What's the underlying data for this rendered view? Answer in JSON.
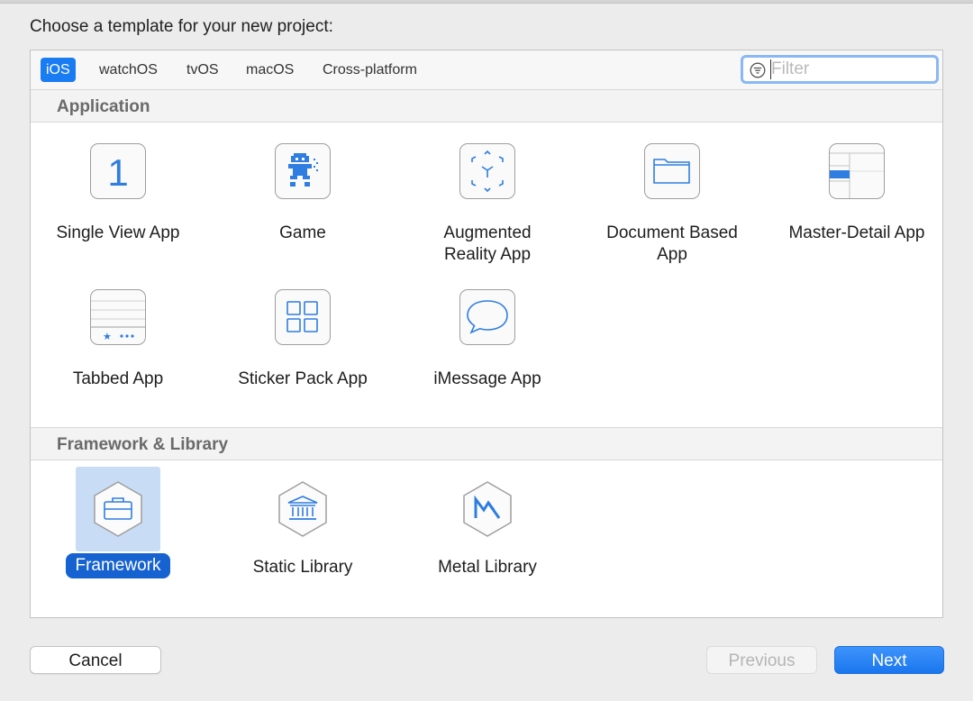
{
  "dialog": {
    "prompt": "Choose a template for your new project:"
  },
  "platform_tabs": [
    {
      "label": "iOS",
      "selected": true
    },
    {
      "label": "watchOS",
      "selected": false
    },
    {
      "label": "tvOS",
      "selected": false
    },
    {
      "label": "macOS",
      "selected": false
    },
    {
      "label": "Cross-platform",
      "selected": false
    }
  ],
  "filter": {
    "placeholder": "Filter",
    "value": ""
  },
  "sections": [
    {
      "title": "Application",
      "templates": [
        {
          "label": "Single View App",
          "icon": "single-view-icon"
        },
        {
          "label": "Game",
          "icon": "game-icon"
        },
        {
          "label": "Augmented Reality App",
          "icon": "augmented-reality-icon"
        },
        {
          "label": "Document Based App",
          "icon": "folder-icon"
        },
        {
          "label": "Master-Detail App",
          "icon": "master-detail-icon"
        },
        {
          "label": "Tabbed App",
          "icon": "tab-bar-icon"
        },
        {
          "label": "Sticker Pack App",
          "icon": "sticker-grid-icon"
        },
        {
          "label": "iMessage App",
          "icon": "speech-bubble-icon"
        }
      ]
    },
    {
      "title": "Framework & Library",
      "templates": [
        {
          "label": "Framework",
          "icon": "toolbox-icon",
          "selected": true
        },
        {
          "label": "Static Library",
          "icon": "bank-building-icon"
        },
        {
          "label": "Metal Library",
          "icon": "metal-icon"
        }
      ]
    }
  ],
  "buttons": {
    "cancel": "Cancel",
    "previous": "Previous",
    "next": "Next"
  },
  "colors": {
    "accent": "#1a7cf2",
    "selection_bg": "#c8dcf6",
    "icon_blue": "#2f7de1"
  }
}
